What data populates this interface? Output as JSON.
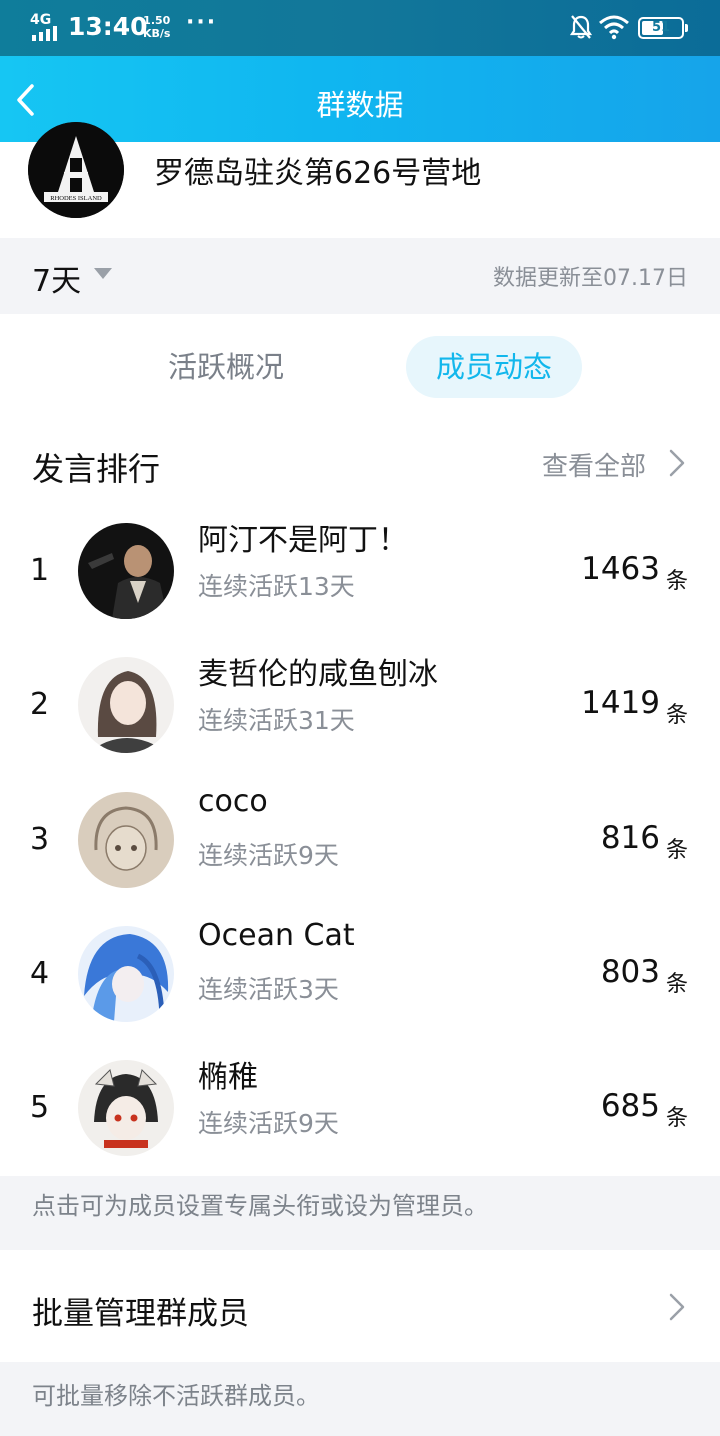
{
  "status_bar": {
    "network": "4G",
    "time": "13:40",
    "speed_value": "1.50",
    "speed_unit": "KB/s",
    "more": "···",
    "battery": "51",
    "icons": [
      "signal-icon",
      "bell-muted-icon",
      "wifi-icon",
      "battery-icon"
    ]
  },
  "header": {
    "title": "群数据",
    "back_icon": "chevron-left-icon"
  },
  "group": {
    "name": "罗德岛驻炎第626号营地",
    "avatar_text": "RHODES ISLAND"
  },
  "period": {
    "value": "7天",
    "update_note": "数据更新至07.17日"
  },
  "tabs": [
    {
      "label": "活跃概况",
      "active": false
    },
    {
      "label": "成员动态",
      "active": true
    }
  ],
  "ranking": {
    "title": "发言排行",
    "view_all": "查看全部",
    "unit": "条",
    "items": [
      {
        "rank": "1",
        "name": "阿汀不是阿丁！",
        "streak": "连续活跃13天",
        "count": "1463"
      },
      {
        "rank": "2",
        "name": "麦哲伦的咸鱼刨冰",
        "streak": "连续活跃31天",
        "count": "1419"
      },
      {
        "rank": "3",
        "name": "coco",
        "streak": "连续活跃9天",
        "count": "816"
      },
      {
        "rank": "4",
        "name": "Ocean Cat",
        "streak": "连续活跃3天",
        "count": "803"
      },
      {
        "rank": "5",
        "name": "椭稚",
        "streak": "连续活跃9天",
        "count": "685"
      }
    ]
  },
  "hint_set_title": "点击可为成员设置专属头衔或设为管理员。",
  "batch": {
    "label": "批量管理群成员",
    "hint": "可批量移除不活跃群成员。"
  },
  "colors": {
    "accent": "#12b7ec",
    "header_gradient_start": "#16c6f3",
    "header_gradient_end": "#16a4ea",
    "tab_active_bg": "#e7f6fc",
    "secondary_text": "#8a8f97"
  }
}
